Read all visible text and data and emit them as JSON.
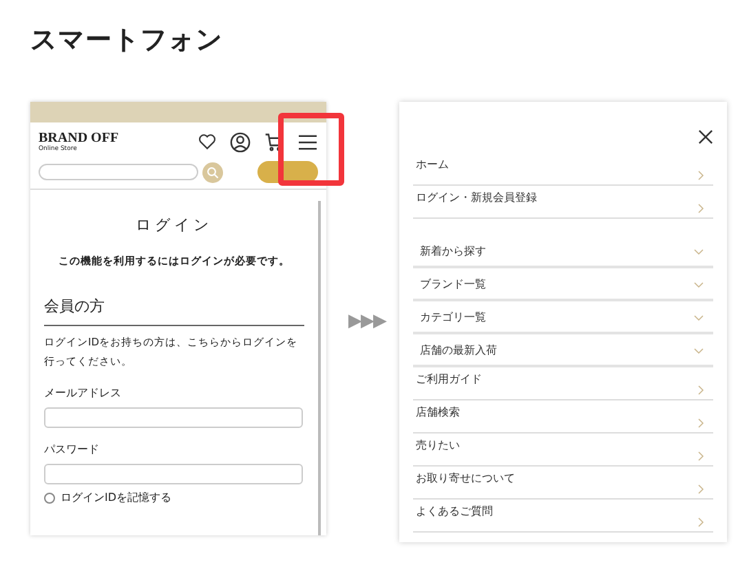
{
  "page_title": "スマートフォン",
  "phone": {
    "logo": "BRAND OFF",
    "logo_sub": "Online Store",
    "login_title": "ログイン",
    "notice": "この機能を利用するにはログインが必要です。",
    "section_title": "会員の方",
    "description": "ログインIDをお持ちの方は、こちらからログインを行ってください。",
    "fields": [
      {
        "label": "メールアドレス"
      },
      {
        "label": "パスワード"
      }
    ],
    "remember": {
      "label": "ログインIDを記憶する",
      "checked": false
    },
    "highlight": true
  },
  "arrow": "▶▶▶",
  "menu": {
    "items": [
      {
        "label": "ホーム",
        "kind": "link"
      },
      {
        "label": "ログイン・新規会員登録",
        "kind": "link"
      },
      {
        "label": "新着から探す",
        "kind": "accordion"
      },
      {
        "label": "ブランド一覧",
        "kind": "accordion"
      },
      {
        "label": "カテゴリ一覧",
        "kind": "accordion"
      },
      {
        "label": "店舗の最新入荷",
        "kind": "accordion"
      },
      {
        "label": "ご利用ガイド",
        "kind": "link"
      },
      {
        "label": "店舗検索",
        "kind": "link"
      },
      {
        "label": "売りたい",
        "kind": "link"
      },
      {
        "label": "お取り寄せについて",
        "kind": "link"
      },
      {
        "label": "よくあるご質問",
        "kind": "link"
      }
    ]
  }
}
